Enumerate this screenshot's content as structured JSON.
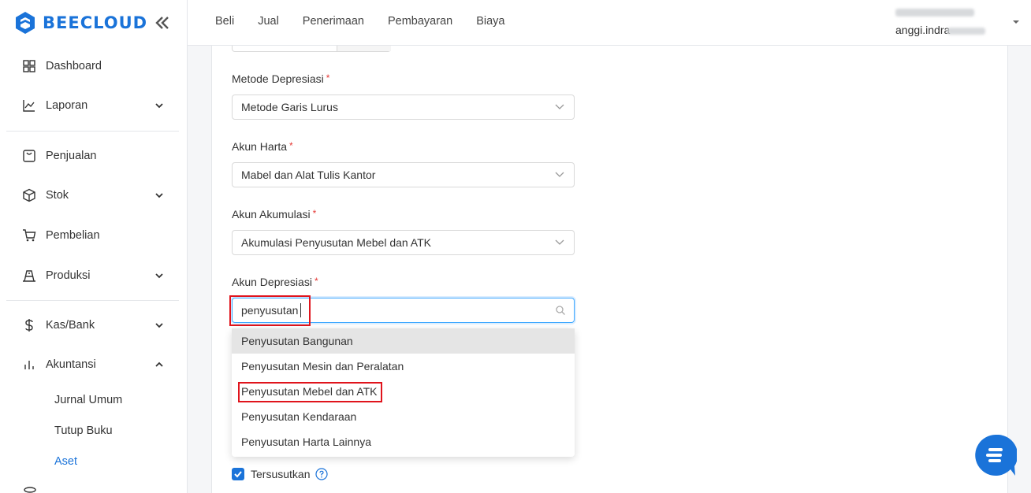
{
  "brand": {
    "name": "BEECLOUD",
    "color": "#1a73d9",
    "logo_icon": "bee-hexagon-logo"
  },
  "sidebar": {
    "items": [
      {
        "label": "Dashboard",
        "icon": "grid-icon",
        "expandable": false
      },
      {
        "label": "Laporan",
        "icon": "line-chart-icon",
        "expandable": true
      },
      {
        "label": "Penjualan",
        "icon": "receipt-icon",
        "expandable": false
      },
      {
        "label": "Stok",
        "icon": "box-icon",
        "expandable": true
      },
      {
        "label": "Pembelian",
        "icon": "cart-icon",
        "expandable": false
      },
      {
        "label": "Produksi",
        "icon": "factory-icon",
        "expandable": true
      },
      {
        "label": "Kas/Bank",
        "icon": "dollar-icon",
        "expandable": true
      },
      {
        "label": "Akuntansi",
        "icon": "bar-chart-icon",
        "expandable": true,
        "expanded": true
      }
    ],
    "akuntansi_sub": [
      "Jurnal Umum",
      "Tutup Buku",
      "Aset"
    ],
    "active_sub": "Aset"
  },
  "topnav": {
    "items": [
      "Beli",
      "Jual",
      "Penerimaan",
      "Pembayaran",
      "Biaya"
    ]
  },
  "user": {
    "email_visible": "anggi.indra"
  },
  "form": {
    "metode_depresiasi": {
      "label": "Metode Depresiasi",
      "required_mark": "*",
      "value": "Metode Garis Lurus"
    },
    "akun_harta": {
      "label": "Akun Harta",
      "required_mark": "*",
      "value": "Mabel dan Alat Tulis Kantor"
    },
    "akun_akumulasi": {
      "label": "Akun Akumulasi",
      "required_mark": "*",
      "value": "Akumulasi Penyusutan Mebel dan ATK"
    },
    "akun_depresiasi": {
      "label": "Akun Depresiasi",
      "required_mark": "*",
      "search_value": "penyusutan",
      "options": [
        "Penyusutan Bangunan",
        "Penyusutan Mesin dan Peralatan",
        "Penyusutan Mebel dan ATK",
        "Penyusutan Kendaraan",
        "Penyusutan Harta Lainnya"
      ],
      "hovered_option": "Penyusutan Bangunan",
      "highlighted_option": "Penyusutan Mebel dan ATK"
    },
    "tersusutkan": {
      "label": "Tersusutkan",
      "checked": true
    }
  },
  "colors": {
    "accent": "#1a73d9",
    "highlight_box": "#e0141c",
    "required": "#e53935"
  }
}
